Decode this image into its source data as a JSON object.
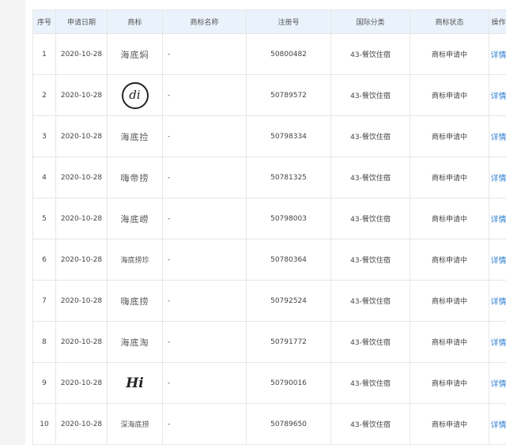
{
  "table": {
    "headers": [
      "序号",
      "申请日期",
      "商标",
      "商标名称",
      "注册号",
      "国际分类",
      "商标状态",
      "操作"
    ],
    "rows": [
      {
        "no": "1",
        "date": "2020-10-28",
        "mark_text": "海底焖",
        "mark_kind": "text",
        "name": "-",
        "reg": "50800482",
        "cls": "43-餐饮住宿",
        "status": "商标申请中",
        "action": "详情"
      },
      {
        "no": "2",
        "date": "2020-10-28",
        "mark_text": "di",
        "mark_kind": "logo-circle",
        "name": "-",
        "reg": "50789572",
        "cls": "43-餐饮住宿",
        "status": "商标申请中",
        "action": "详情"
      },
      {
        "no": "3",
        "date": "2020-10-28",
        "mark_text": "海底捡",
        "mark_kind": "text",
        "name": "-",
        "reg": "50798334",
        "cls": "43-餐饮住宿",
        "status": "商标申请中",
        "action": "详情"
      },
      {
        "no": "4",
        "date": "2020-10-28",
        "mark_text": "嗨帝捞",
        "mark_kind": "text",
        "name": "-",
        "reg": "50781325",
        "cls": "43-餐饮住宿",
        "status": "商标申请中",
        "action": "详情"
      },
      {
        "no": "5",
        "date": "2020-10-28",
        "mark_text": "海底崂",
        "mark_kind": "text",
        "name": "-",
        "reg": "50798003",
        "cls": "43-餐饮住宿",
        "status": "商标申请中",
        "action": "详情"
      },
      {
        "no": "6",
        "date": "2020-10-28",
        "mark_text": "海底捞珍",
        "mark_kind": "text-small",
        "name": "-",
        "reg": "50780364",
        "cls": "43-餐饮住宿",
        "status": "商标申请中",
        "action": "详情"
      },
      {
        "no": "7",
        "date": "2020-10-28",
        "mark_text": "嗨底捞",
        "mark_kind": "text",
        "name": "-",
        "reg": "50792524",
        "cls": "43-餐饮住宿",
        "status": "商标申请中",
        "action": "详情"
      },
      {
        "no": "8",
        "date": "2020-10-28",
        "mark_text": "海底淘",
        "mark_kind": "text",
        "name": "-",
        "reg": "50791772",
        "cls": "43-餐饮住宿",
        "status": "商标申请中",
        "action": "详情"
      },
      {
        "no": "9",
        "date": "2020-10-28",
        "mark_text": "Hi",
        "mark_kind": "logo-hi",
        "name": "-",
        "reg": "50790016",
        "cls": "43-餐饮住宿",
        "status": "商标申请中",
        "action": "详情"
      },
      {
        "no": "10",
        "date": "2020-10-28",
        "mark_text": "深海底捞",
        "mark_kind": "text-small",
        "name": "-",
        "reg": "50789650",
        "cls": "43-餐饮住宿",
        "status": "商标申请中",
        "action": "详情"
      }
    ]
  }
}
